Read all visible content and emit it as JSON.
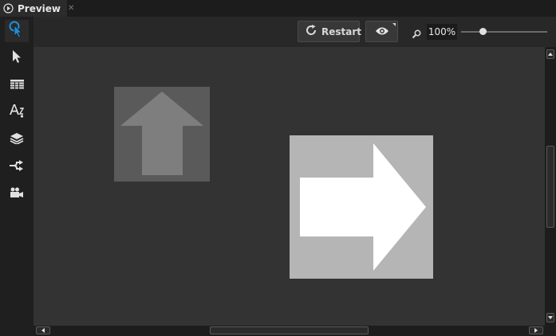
{
  "tab": {
    "title": "Preview",
    "close_glyph": "✕",
    "icon": "play-circle-icon"
  },
  "toolbar": {
    "restart_label": "Restart",
    "restart_icon": "restart-icon",
    "visibility_icon": "eye-icon",
    "zoom_icon": "magnifier-icon",
    "zoom_level": "100%",
    "zoom_slider_fraction": 0.25
  },
  "sidebar": {
    "tools": [
      {
        "name": "interact-tool",
        "icon": "touch-pointer-icon",
        "active": true
      },
      {
        "name": "select-tool",
        "icon": "arrow-pointer-icon",
        "active": false
      },
      {
        "name": "grid-tool",
        "icon": "table-icon",
        "active": false
      },
      {
        "name": "text-tool",
        "icon": "text-icon",
        "active": false
      },
      {
        "name": "layers-tool",
        "icon": "layers-icon",
        "active": false
      },
      {
        "name": "routing-tool",
        "icon": "route-icon",
        "active": false
      },
      {
        "name": "camera-tool",
        "icon": "camera-icon",
        "active": false
      }
    ]
  },
  "canvas": {
    "up_arrow_box": {
      "icon": "up-arrow-icon",
      "box_color": "#5a5a5a",
      "arrow_color": "#7e7e7e"
    },
    "right_arrow_box": {
      "icon": "right-arrow-icon",
      "box_color": "#b5b5b5",
      "arrow_color": "#ffffff"
    }
  },
  "colors": {
    "accent": "#1e8fd9",
    "background": "#333333"
  }
}
